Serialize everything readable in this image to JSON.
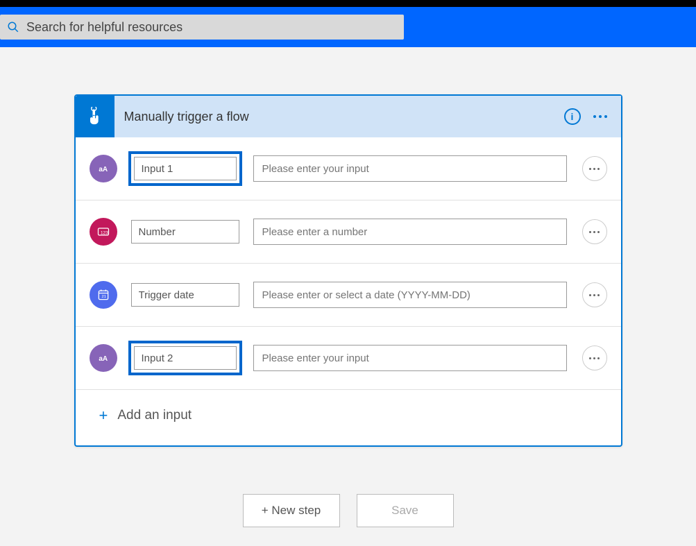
{
  "search": {
    "placeholder": "Search for helpful resources"
  },
  "trigger": {
    "title": "Manually trigger a flow",
    "inputs": [
      {
        "icon": "text",
        "name": "Input 1",
        "placeholder": "Please enter your input",
        "highlighted": true
      },
      {
        "icon": "number",
        "name": "Number",
        "placeholder": "Please enter a number",
        "highlighted": false
      },
      {
        "icon": "date",
        "name": "Trigger date",
        "placeholder": "Please enter or select a date (YYYY-MM-DD)",
        "highlighted": false
      },
      {
        "icon": "text",
        "name": "Input 2",
        "placeholder": "Please enter your input",
        "highlighted": true
      }
    ],
    "addInput": "Add an input"
  },
  "buttons": {
    "newStep": "+ New step",
    "save": "Save"
  }
}
